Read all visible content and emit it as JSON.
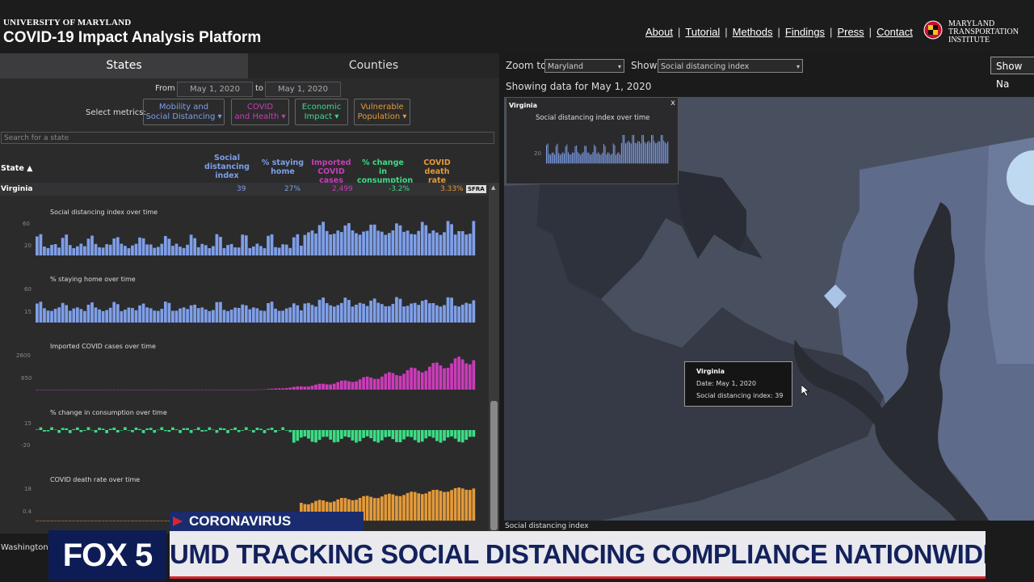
{
  "header": {
    "university": "UNIVERSITY OF MARYLAND",
    "title": "COVID-19 Impact Analysis Platform",
    "nav": [
      "About",
      "Tutorial",
      "Methods",
      "Findings",
      "Press",
      "Contact"
    ],
    "institute": [
      "MARYLAND",
      "TRANSPORTATION",
      "INSTITUTE"
    ]
  },
  "left": {
    "tabs": {
      "states": "States",
      "counties": "Counties"
    },
    "from_label": "From",
    "to_label": "to",
    "from_date": "May 1, 2020",
    "to_date": "May 1, 2020",
    "select_metrics_label": "Select metrics:",
    "metric_boxes": [
      {
        "line1": "Mobility and",
        "line2": "Social Distancing",
        "color": "#7f9fe8"
      },
      {
        "line1": "COVID",
        "line2": "and Health",
        "color": "#c93cb8"
      },
      {
        "line1": "Economic",
        "line2": "Impact",
        "color": "#3ddc84"
      },
      {
        "line1": "Vulnerable",
        "line2": "Population",
        "color": "#e39a3a"
      }
    ],
    "search_placeholder": "Search for a state",
    "columns": {
      "state": "State ▲",
      "sdi": [
        "Social",
        "distancing",
        "index"
      ],
      "staying": [
        "% staying",
        "home"
      ],
      "imported": [
        "Imported",
        "COVID cases"
      ],
      "consumption": [
        "% change in",
        "consumption"
      ],
      "death": [
        "COVID death",
        "rate"
      ]
    },
    "row": {
      "state": "Virginia",
      "sdi": "39",
      "staying": "27%",
      "imported": "2,499",
      "consumption": "-3.2%",
      "death": "3.33%",
      "badge": "SFRA"
    },
    "charts": [
      {
        "label": "Social distancing index over time",
        "ticks": [
          "60",
          "20"
        ],
        "color": "#7f9fe8"
      },
      {
        "label": "% staying home over time",
        "ticks": [
          "60",
          "15"
        ],
        "color": "#7f9fe8"
      },
      {
        "label": "Imported COVID cases over time",
        "ticks": [
          "2600",
          "650"
        ],
        "color": "#c93cb8"
      },
      {
        "label": "% change in consumption over time",
        "ticks": [
          "15",
          "-20"
        ],
        "color": "#3ddc84"
      },
      {
        "label": "COVID death rate over time",
        "ticks": [
          "18",
          "0.4"
        ],
        "color": "#e39a3a"
      }
    ],
    "next_row": "Washington"
  },
  "map": {
    "zoom_label": "Zoom to",
    "zoom_value": "Maryland",
    "show_label": "Show",
    "show_value": "Social distancing index",
    "show_button": "Show Na",
    "showing": "Showing data for May 1, 2020",
    "mini_chart": {
      "state": "Virginia",
      "title": "Social distancing index over time",
      "tick": "20",
      "close": "x"
    },
    "tooltip": {
      "state": "Virginia",
      "date": "Date: May 1, 2020",
      "value": "Social distancing index: 39"
    },
    "legend_label": "Social distancing index"
  },
  "tv": {
    "category": "CORONAVIRUS",
    "station": "FOX 5",
    "headline": "UMD TRACKING SOCIAL DISTANCING COMPLIANCE NATIONWIDE"
  }
}
